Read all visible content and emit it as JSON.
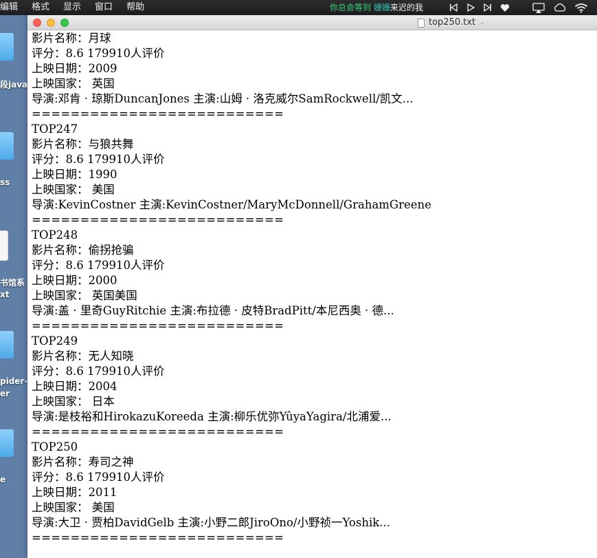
{
  "menubar": {
    "items": [
      "编辑",
      "格式",
      "显示",
      "窗口",
      "帮助"
    ],
    "now_playing": {
      "part1": "你总会等到 ",
      "part2": "姗姗",
      "part3": "来迟的我"
    }
  },
  "desktop": {
    "labels": [
      "段java",
      "ss",
      "书馆系",
      "xt",
      "pider-",
      "er",
      "e"
    ]
  },
  "window": {
    "title": "top250.txt"
  },
  "document": {
    "lines": [
      "影片名称：月球",
      "评分：8.6 179910人评价",
      "上映日期：2009",
      "上映国家： 英国",
      "导演:邓肯 · 琼斯DuncanJones   主演:山姆 · 洛克威尔SamRockwell/凯文...",
      "==========================",
      "TOP247",
      "影片名称：与狼共舞",
      "评分：8.6 179910人评价",
      "上映日期：1990",
      "上映国家： 美国",
      "导演:KevinCostner   主演:KevinCostner/MaryMcDonnell/GrahamGreene",
      "==========================",
      "TOP248",
      "影片名称：偷拐抢骗",
      "评分：8.6 179910人评价",
      "上映日期：2000",
      "上映国家： 英国美国",
      "导演:盖 · 里奇GuyRitchie   主演:布拉德 · 皮特BradPitt/本尼西奥 · 德...",
      "==========================",
      "TOP249",
      "影片名称：无人知晓",
      "评分：8.6 179910人评价",
      "上映日期：2004",
      "上映国家： 日本",
      "导演:是枝裕和HirokazuKoreeda   主演:柳乐优弥YûyaYagira/北浦爱...",
      "==========================",
      "TOP250",
      "影片名称：寿司之神",
      "评分：8.6 179910人评价",
      "上映日期：2011",
      "上映国家： 美国",
      "导演:大卫 · 贾柏DavidGelb   主演:小野二郎JiroOno/小野祯一Yoshik...",
      "=========================="
    ]
  }
}
